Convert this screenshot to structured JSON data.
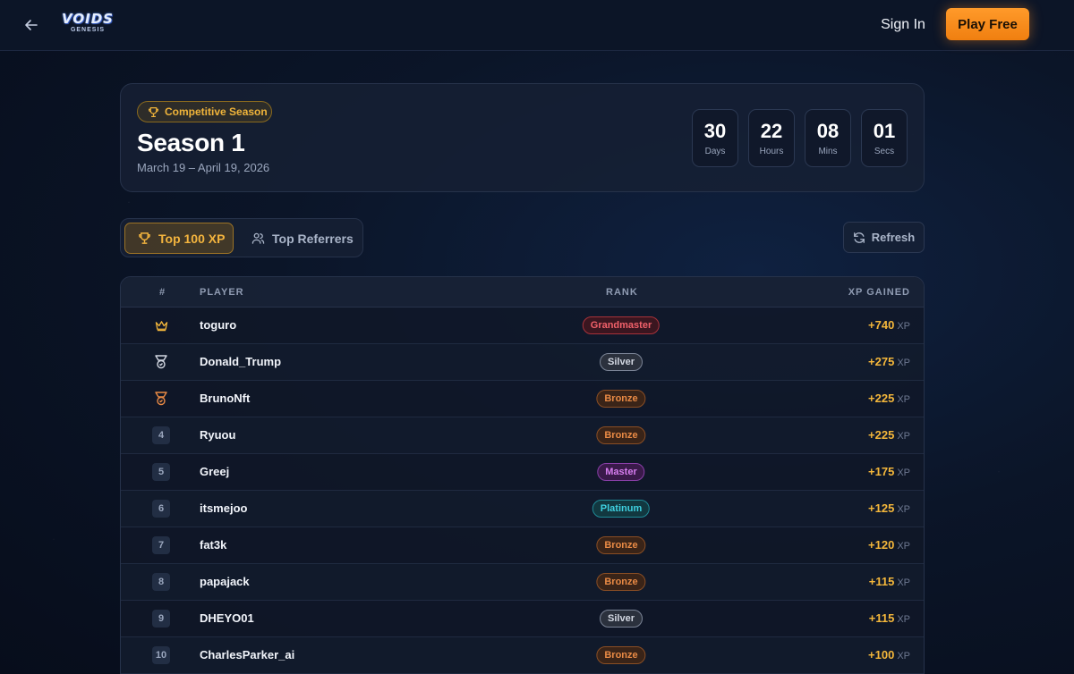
{
  "header": {
    "logo_text": "VOIDS",
    "logo_subtext": "GENESIS",
    "signin_label": "Sign In",
    "play_label": "Play Free"
  },
  "season": {
    "badge": "Competitive Season",
    "title": "Season 1",
    "dates": "March 19 – April 19, 2026",
    "countdown": [
      {
        "value": "30",
        "label": "Days"
      },
      {
        "value": "22",
        "label": "Hours"
      },
      {
        "value": "08",
        "label": "Mins"
      },
      {
        "value": "01",
        "label": "Secs"
      }
    ]
  },
  "tabs": {
    "xp": "Top 100 XP",
    "referrers": "Top Referrers",
    "refresh": "Refresh"
  },
  "table": {
    "headers": {
      "rank": "#",
      "player": "PLAYER",
      "tier": "RANK",
      "xp": "XP GAINED"
    },
    "xp_unit": "XP",
    "rows": [
      {
        "rank": "1",
        "icon": "crown-icon",
        "player": "toguro",
        "tier": "Grandmaster",
        "xp": "+740"
      },
      {
        "rank": "2",
        "icon": "silver-medal-icon",
        "player": "Donald_Trump",
        "tier": "Silver",
        "xp": "+275"
      },
      {
        "rank": "3",
        "icon": "bronze-medal-icon",
        "player": "BrunoNft",
        "tier": "Bronze",
        "xp": "+225"
      },
      {
        "rank": "4",
        "player": "Ryuou",
        "tier": "Bronze",
        "xp": "+225"
      },
      {
        "rank": "5",
        "player": "Greej",
        "tier": "Master",
        "xp": "+175"
      },
      {
        "rank": "6",
        "player": "itsmejoo",
        "tier": "Platinum",
        "xp": "+125"
      },
      {
        "rank": "7",
        "player": "fat3k",
        "tier": "Bronze",
        "xp": "+120"
      },
      {
        "rank": "8",
        "player": "papajack",
        "tier": "Bronze",
        "xp": "+115"
      },
      {
        "rank": "9",
        "player": "DHEYO01",
        "tier": "Silver",
        "xp": "+115"
      },
      {
        "rank": "10",
        "player": "CharlesParker_ai",
        "tier": "Bronze",
        "xp": "+100"
      }
    ]
  },
  "tier_colors": {
    "Grandmaster": {
      "text": "#f2616a",
      "border": "#a8323a",
      "bg": "#3b1620"
    },
    "Silver": {
      "text": "#d3d8e2",
      "border": "#7b8496",
      "bg": "#2b313d"
    },
    "Bronze": {
      "text": "#e98a45",
      "border": "#8a4e24",
      "bg": "#3a2418"
    },
    "Master": {
      "text": "#d77ef0",
      "border": "#8a3fa8",
      "bg": "#3a1a4a"
    },
    "Platinum": {
      "text": "#3fd0e0",
      "border": "#1f8a96",
      "bg": "#123840"
    }
  },
  "colors": {
    "accent": "#f39a24",
    "xp": "#f4b73b",
    "background": "#0b1528"
  }
}
